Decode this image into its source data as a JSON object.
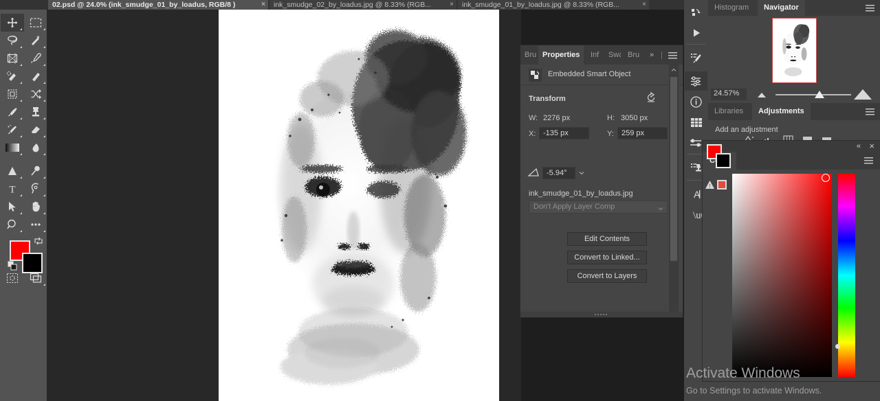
{
  "app": {
    "name": "Adobe Photoshop"
  },
  "document_tabs": [
    {
      "label": "02.psd @ 24.0% (ink_smudge_01_by_loadus, RGB/8 )",
      "active": true,
      "close": "×"
    },
    {
      "label": "ink_smudge_02_by_loadus.jpg @ 8.33% (RGB...",
      "active": false,
      "close": "×"
    },
    {
      "label": "ink_smudge_01_by_loadus.jpg @ 8.33% (RGB...",
      "active": false,
      "close": "×"
    }
  ],
  "toolbar": {
    "tools": [
      {
        "name": "move-tool",
        "selected": true
      },
      {
        "name": "rectangular-marquee-tool",
        "selected": false
      },
      {
        "name": "lasso-tool",
        "selected": false
      },
      {
        "name": "object-selection-tool",
        "selected": false
      },
      {
        "name": "crop-tool",
        "selected": false
      },
      {
        "name": "eyedropper-tool",
        "selected": false
      },
      {
        "name": "spot-healing-brush-tool",
        "selected": false
      },
      {
        "name": "healing-brush-tool",
        "selected": false
      },
      {
        "name": "frame-tool",
        "selected": false
      },
      {
        "name": "shuffle-tool",
        "selected": false
      },
      {
        "name": "brush-tool",
        "selected": false
      },
      {
        "name": "clone-stamp-tool",
        "selected": false
      },
      {
        "name": "history-brush-tool",
        "selected": false
      },
      {
        "name": "eraser-tool",
        "selected": false
      },
      {
        "name": "gradient-tool",
        "selected": false
      },
      {
        "name": "blur-tool",
        "selected": false
      },
      {
        "name": "dodge-tool",
        "selected": false
      },
      {
        "name": "pen-tool",
        "selected": false
      },
      {
        "name": "horizontal-type-tool",
        "selected": false
      },
      {
        "name": "path-selection-tool",
        "selected": false
      },
      {
        "name": "hand-tool",
        "selected": false
      },
      {
        "name": "zoom-tool",
        "selected": false
      },
      {
        "name": "edit-toolbar-tool",
        "selected": false
      },
      {
        "name": "quick-mask-tool",
        "selected": false
      },
      {
        "name": "screen-mode-tool",
        "selected": false
      }
    ],
    "foreground_color": "#ff0000",
    "background_color": "#000000"
  },
  "properties_panel": {
    "tabs": [
      {
        "label": "Bru",
        "active": false
      },
      {
        "label": "Properties",
        "active": true
      },
      {
        "label": "Inf",
        "active": false
      },
      {
        "label": "Swa",
        "active": false
      },
      {
        "label": "Bru",
        "active": false
      }
    ],
    "overflow": "»",
    "menu_icon": "hamburger-menu-icon",
    "object_type": "Embedded Smart Object",
    "object_icon": "smart-object-icon",
    "section_title": "Transform",
    "reset_icon": "reset-arrow-icon",
    "transform": {
      "w_label": "W:",
      "w_value": "2276 px",
      "h_label": "H:",
      "h_value": "3050 px",
      "x_label": "X:",
      "x_value": "-135 px",
      "y_label": "Y:",
      "y_value": "259 px",
      "angle_icon": "angle-icon",
      "angle_value": "-5.94°"
    },
    "file_name": "ink_smudge_01_by_loadus.jpg",
    "layer_comp": "Don't Apply Layer Comp",
    "buttons": [
      {
        "label": "Edit Contents"
      },
      {
        "label": "Convert to Linked..."
      },
      {
        "label": "Convert to Layers"
      }
    ]
  },
  "dock": {
    "items": [
      {
        "name": "history-icon",
        "selected": false
      },
      {
        "name": "actions-play-icon",
        "selected": false
      },
      {
        "name": "brush-settings-icon",
        "selected": false
      },
      {
        "name": "adjustments-sliders-icon",
        "selected": true
      },
      {
        "name": "info-icon",
        "selected": false
      },
      {
        "name": "swatches-grid-icon",
        "selected": false
      },
      {
        "name": "properties-sliders-icon",
        "selected": false
      },
      {
        "name": "clone-source-icon",
        "selected": false
      },
      {
        "name": "character-icon",
        "selected": false
      },
      {
        "name": "paragraph-icon",
        "selected": false
      }
    ]
  },
  "navigator_panel": {
    "tabs": [
      {
        "label": "Histogram",
        "active": false
      },
      {
        "label": "Navigator",
        "active": true
      }
    ],
    "menu_icon": "hamburger-menu-icon",
    "zoom_value": "24.57%",
    "zoom_out_icon": "small-mountain-icon",
    "zoom_in_icon": "large-mountain-icon",
    "slider_handle_icon": "slider-handle-icon"
  },
  "adjustments_panel": {
    "tabs": [
      {
        "label": "Libraries",
        "active": false
      },
      {
        "label": "Adjustments",
        "active": true
      }
    ],
    "menu_icon": "hamburger-menu-icon",
    "hint": "Add an adjustment",
    "icons": [
      "brightness-contrast-icon",
      "levels-icon",
      "curves-icon",
      "exposure-icon",
      "vibrance-icon"
    ]
  },
  "color_panel": {
    "title": "Color",
    "collapse_icon": "«",
    "close_icon": "×",
    "menu_icon": "hamburger-menu-icon",
    "foreground_color": "#ff0000",
    "background_color": "#000000",
    "out_of_gamut_icon": "gamut-warning-icon",
    "out_of_gamut_swatch": "#e84a3a",
    "picker_type": "hue-cube"
  },
  "watermark": {
    "title": "Activate Windows",
    "subtitle": "Go to Settings to activate Windows."
  }
}
